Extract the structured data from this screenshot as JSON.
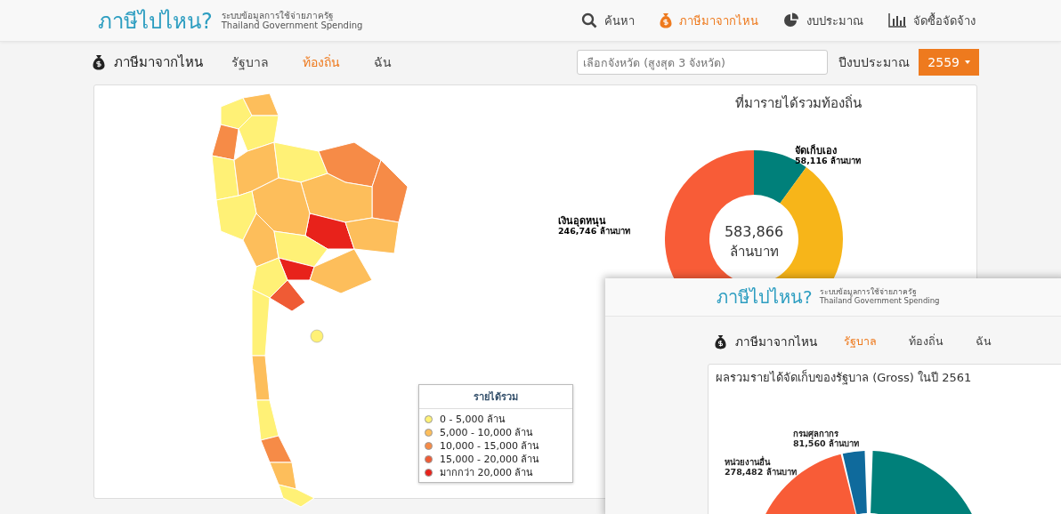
{
  "header": {
    "logo": "ภาษีไปไหน?",
    "subtitle_th": "ระบบข้อมูลการใช้จ่ายภาครัฐ",
    "subtitle_en": "Thailand Government Spending"
  },
  "nav": [
    {
      "kind": "search",
      "label": "ค้นหา",
      "selected": false
    },
    {
      "kind": "money",
      "label": "ภาษีมาจากไหน",
      "selected": true
    },
    {
      "kind": "pie",
      "label": "งบประมาณ",
      "selected": false
    },
    {
      "kind": "bars",
      "label": "จัดซื้อจัดจ้าง",
      "selected": false
    }
  ],
  "subnav": {
    "title": "ภาษีมาจากไหน",
    "tabs": [
      {
        "label": "รัฐบาล",
        "selected": false
      },
      {
        "label": "ท้องถิ่น",
        "selected": true
      },
      {
        "label": "ฉัน",
        "selected": false
      }
    ]
  },
  "province_field": {
    "placeholder": "เลือกจังหวัด (สูงสุด 3 จังหวัด)"
  },
  "year": {
    "label": "ปีงบประมาณ",
    "value": "2559"
  },
  "donut": {
    "title": "ที่มารายได้รวมท้องถิ่น",
    "total": "583,866",
    "unit": "ล้านบาท",
    "labels": [
      {
        "name": "จัดเก็บเอง",
        "value": "58,116 ล้านบาท"
      },
      {
        "name": "เงินอุดหนุน",
        "value": "246,746 ล้านบาท"
      }
    ]
  },
  "legend": {
    "title": "รายได้รวม",
    "items": [
      {
        "label": "0 - 5,000 ล้าน",
        "color": "#fff176"
      },
      {
        "label": "5,000 - 10,000 ล้าน",
        "color": "#fdbe5b"
      },
      {
        "label": "10,000 - 15,000 ล้าน",
        "color": "#f68b47"
      },
      {
        "label": "15,000 - 20,000 ล้าน",
        "color": "#ef5b35"
      },
      {
        "label": "มากกว่า 20,000 ล้าน",
        "color": "#e8221b"
      }
    ]
  },
  "overlay": {
    "logo": "ภาษีไปไหน?",
    "subtitle_th": "ระบบข้อมูลการใช้จ่ายภาครัฐ",
    "subtitle_en": "Thailand Government Spending",
    "subnav_title": "ภาษีมาจากไหน",
    "tabs": [
      {
        "label": "รัฐบาล",
        "selected": true
      },
      {
        "label": "ท้องถิ่น",
        "selected": false
      },
      {
        "label": "ฉัน",
        "selected": false
      }
    ],
    "card_title": "ผลรวมรายได้จัดเก็บของรัฐบาล (Gross) ในปี 2561",
    "labels": [
      {
        "name": "กรมศุลกากร",
        "value": "81,560 ล้านบาท"
      },
      {
        "name": "หน่วยงานอื่น",
        "value": "278,482 ล้านบาท"
      }
    ]
  }
}
